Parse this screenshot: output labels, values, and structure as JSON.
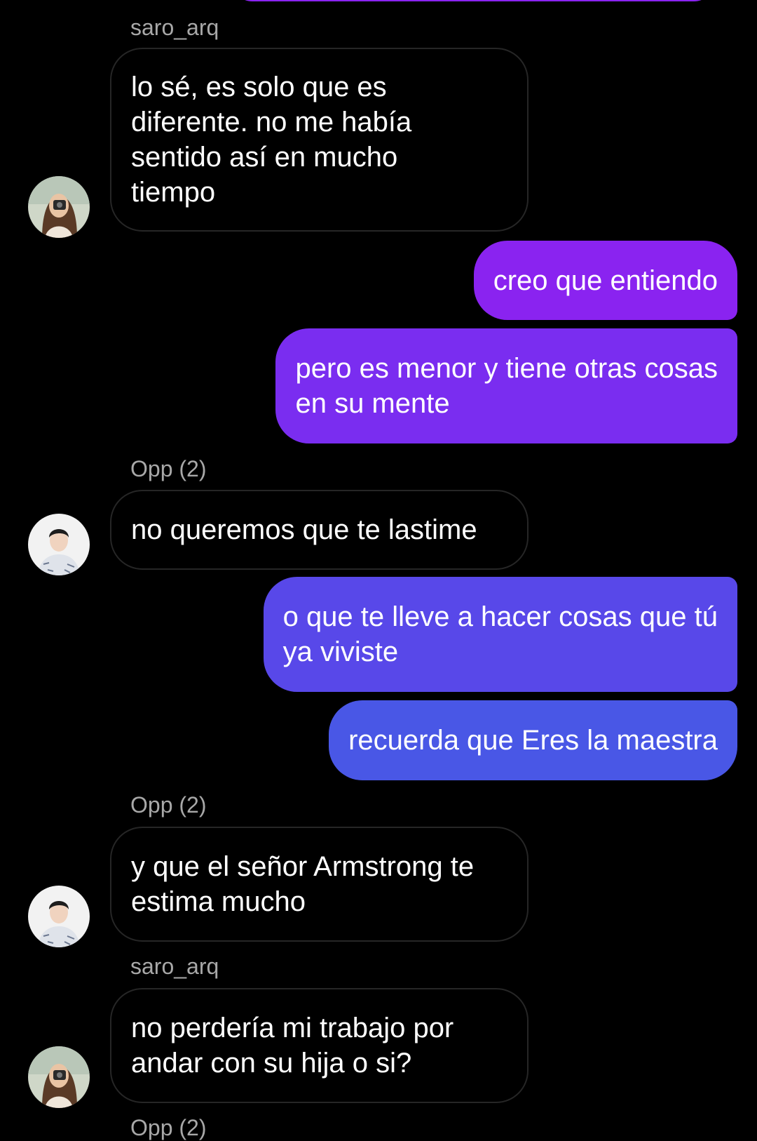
{
  "colors": {
    "background": "#000000",
    "incoming_border": "#262626",
    "sender_name": "#a8a8a8",
    "outgoing_gradient": [
      "#8a23f0",
      "#7a2df0",
      "#6a3cee",
      "#5848e9",
      "#4957e6"
    ]
  },
  "thread": {
    "messages": [
      {
        "sender": "saro_arq",
        "direction": "incoming",
        "avatar": "avatar-saro-icon",
        "lines": [
          "lo sé, es solo que es",
          "diferente. no me había",
          "sentido así en mucho",
          "tiempo"
        ]
      },
      {
        "direction": "outgoing",
        "lines": [
          "creo que entiendo"
        ]
      },
      {
        "direction": "outgoing",
        "lines": [
          "pero es menor y tiene otras cosas",
          "en su mente"
        ]
      },
      {
        "sender": "Opp (2)",
        "direction": "incoming",
        "avatar": "avatar-opp-icon",
        "lines": [
          "no queremos que te lastime"
        ]
      },
      {
        "direction": "outgoing",
        "lines": [
          "o que te lleve a hacer cosas que tú",
          "ya viviste"
        ]
      },
      {
        "direction": "outgoing",
        "lines": [
          "recuerda que Eres la maestra"
        ]
      },
      {
        "sender": "Opp (2)",
        "direction": "incoming",
        "avatar": "avatar-opp-icon",
        "lines": [
          "y que el señor Armstrong te",
          "estima mucho"
        ]
      },
      {
        "sender": "saro_arq",
        "direction": "incoming",
        "avatar": "avatar-saro-icon",
        "lines": [
          "no perdería mi trabajo por",
          "andar con su hija o si?"
        ]
      }
    ],
    "trailing_sender": "Opp (2)"
  }
}
